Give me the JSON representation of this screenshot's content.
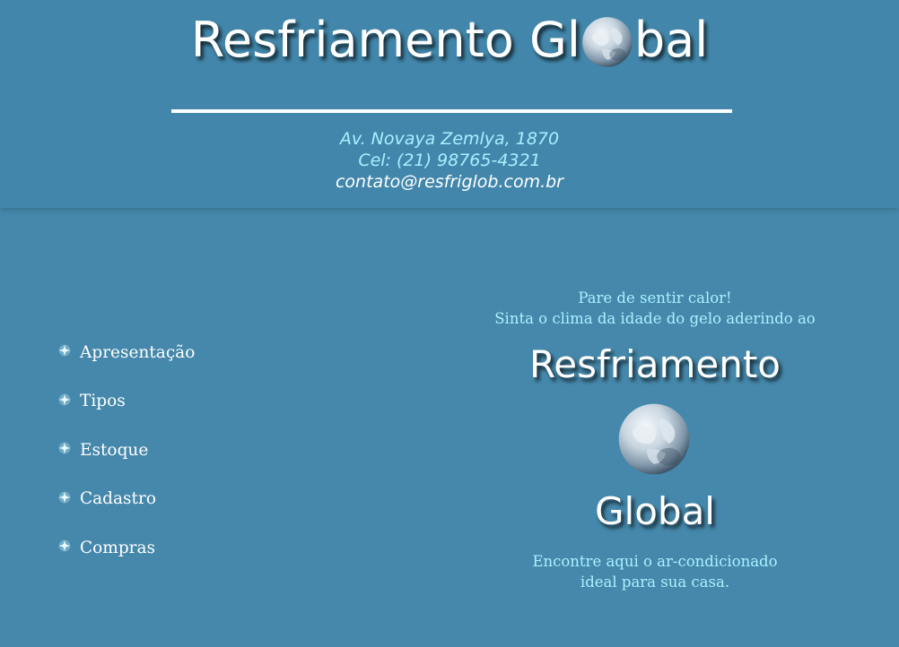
{
  "header": {
    "logo": {
      "part1": "Resfriamento Gl",
      "globe_icon": "globe-icon",
      "part2": "bal"
    },
    "address": "Av. Novaya Zemlya, 1870",
    "phone": "Cel: (21) 98765-4321",
    "email": "contato@resfriglob.com.br"
  },
  "nav": {
    "bullet_icon": "snowflake-bullet-icon",
    "items": [
      {
        "label": "Apresentação"
      },
      {
        "label": "Tipos"
      },
      {
        "label": "Estoque"
      },
      {
        "label": "Cadastro"
      },
      {
        "label": "Compras"
      }
    ]
  },
  "promo": {
    "line1": "Pare de sentir calor!",
    "line2": "Sinta o clima da idade do gelo aderindo ao",
    "word1": "Resfriamento",
    "word2": "Global",
    "foot1": "Encontre aqui o ar-condicionado",
    "foot2": "ideal para sua casa."
  },
  "colors": {
    "background": "#4588ab",
    "accent_text": "#a9f1ff",
    "white": "#ffffff"
  }
}
